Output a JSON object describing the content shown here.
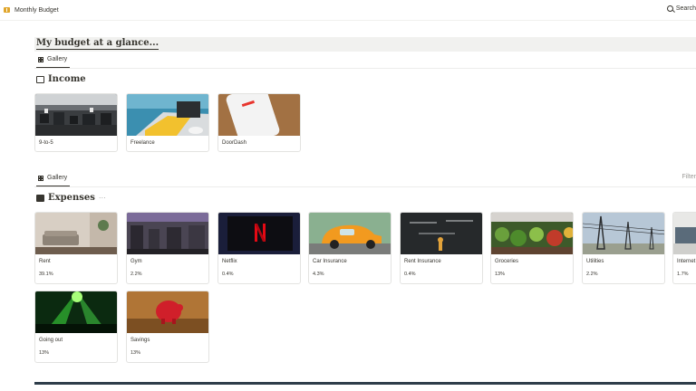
{
  "topbar": {
    "title": "Monthly Budget",
    "search_label": "Search"
  },
  "callout": {
    "title": "My budget at a glance..."
  },
  "income": {
    "view_label": "Gallery",
    "heading": "Income",
    "cards": [
      {
        "name": "9-to-5"
      },
      {
        "name": "Freelance"
      },
      {
        "name": "DoorDash"
      }
    ]
  },
  "expenses": {
    "view_label": "Gallery",
    "heading": "Expenses",
    "more": "···",
    "filter_label": "Filter",
    "cards": [
      {
        "name": "Rent",
        "pct": "39.1%"
      },
      {
        "name": "Gym",
        "pct": "2.2%"
      },
      {
        "name": "Netflix",
        "pct": "0.4%"
      },
      {
        "name": "Car Insurance",
        "pct": "4.3%"
      },
      {
        "name": "Rent Insurance",
        "pct": "0.4%"
      },
      {
        "name": "Groceries",
        "pct": "13%"
      },
      {
        "name": "Utilities",
        "pct": "2.2%"
      },
      {
        "name": "Internet",
        "pct": "1.7%"
      },
      {
        "name": "Going out",
        "pct": "13%"
      },
      {
        "name": "Savings",
        "pct": "13%"
      }
    ]
  },
  "icons": {
    "book": "book-icon",
    "search": "search-icon",
    "gallery": "grid-icon",
    "income": "money-icon",
    "expenses": "wallet-icon"
  },
  "colors": {
    "callout_bg": "#f1f1ef",
    "text": "#37352f",
    "bottom_bar": "#2e3d4a"
  }
}
